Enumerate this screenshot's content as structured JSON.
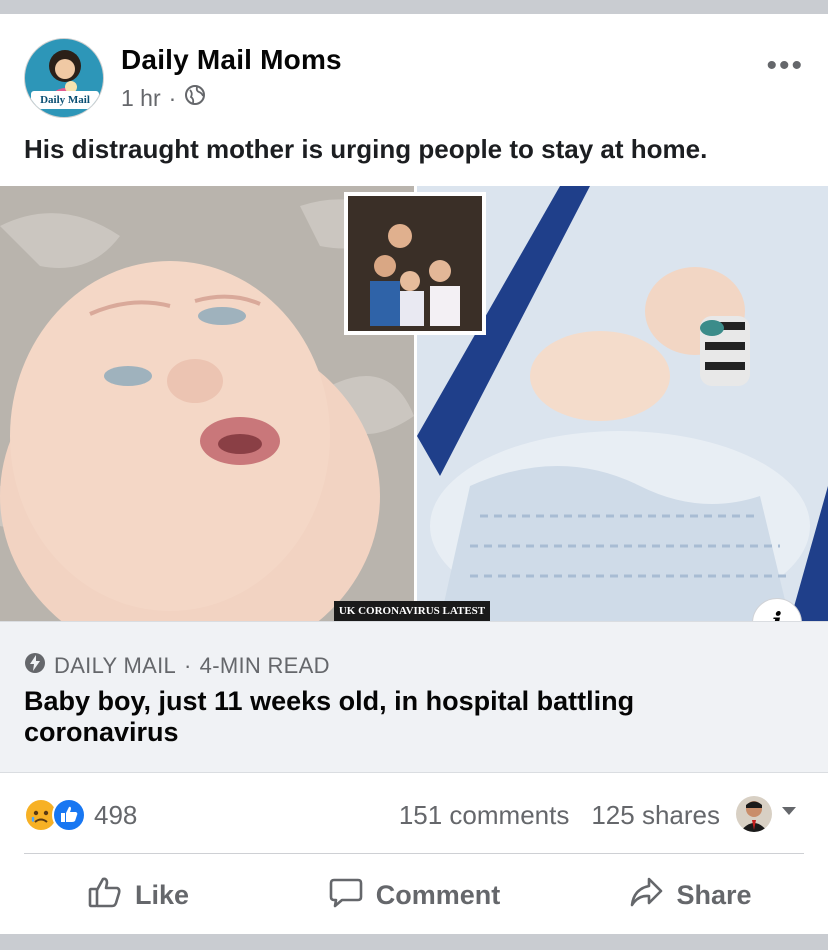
{
  "post": {
    "page_name": "Daily Mail Moms",
    "time": "1 hr",
    "separator": "·",
    "more_label": "•••",
    "avatar_brand": "Daily Mail",
    "caption": "His distraught mother is urging people to stay at home."
  },
  "image": {
    "banner_text": "UK CORONAVIRUS LATEST",
    "info_label": "i"
  },
  "link": {
    "source": "DAILY MAIL",
    "dot": "·",
    "read_time": "4-MIN READ",
    "headline": "Baby boy, just 11 weeks old, in hospital battling coronavirus"
  },
  "engagement": {
    "reactions_count": "498",
    "comments": "151 comments",
    "shares": "125 shares"
  },
  "actions": {
    "like": "Like",
    "comment": "Comment",
    "share": "Share"
  },
  "icons": {
    "more": "more-options-icon",
    "globe": "globe-icon",
    "lightning": "instant-article-icon",
    "sad": "sad-reaction-icon",
    "like_reaction": "like-reaction-icon",
    "caret": "caret-down-icon",
    "thumb": "thumbs-up-icon",
    "speech": "comment-bubble-icon",
    "share": "share-arrow-icon"
  },
  "colors": {
    "brand_blue": "#1877f2",
    "muted_text": "#65676b",
    "separator_grey": "#c9ccd1"
  }
}
